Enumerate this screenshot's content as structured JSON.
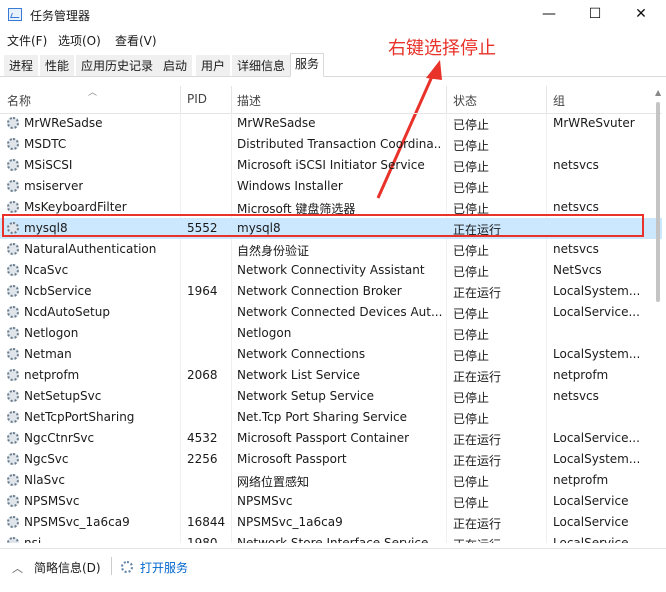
{
  "window": {
    "title": "任务管理器",
    "minimize": "—",
    "maximize": "☐",
    "close": "✕"
  },
  "menu": [
    "文件(F)",
    "选项(O)",
    "查看(V)"
  ],
  "tabs": [
    "进程",
    "性能",
    "应用历史记录",
    "启动",
    "用户",
    "详细信息",
    "服务"
  ],
  "active_tab": "服务",
  "annotation": {
    "text": "右键选择停止",
    "color": "#e8322a"
  },
  "columns": [
    "名称",
    "PID",
    "描述",
    "状态",
    "组"
  ],
  "services": [
    {
      "name": "MrWReSadse",
      "pid": "",
      "desc": "MrWReSadse",
      "status": "已停止",
      "group": "MrWReSvuter"
    },
    {
      "name": "MSDTC",
      "pid": "",
      "desc": "Distributed Transaction Coordina...",
      "status": "已停止",
      "group": ""
    },
    {
      "name": "MSiSCSI",
      "pid": "",
      "desc": "Microsoft iSCSI Initiator Service",
      "status": "已停止",
      "group": "netsvcs"
    },
    {
      "name": "msiserver",
      "pid": "",
      "desc": "Windows Installer",
      "status": "已停止",
      "group": ""
    },
    {
      "name": "MsKeyboardFilter",
      "pid": "",
      "desc": "Microsoft 键盘筛选器",
      "status": "已停止",
      "group": "netsvcs"
    },
    {
      "name": "mysql8",
      "pid": "5552",
      "desc": "mysql8",
      "status": "正在运行",
      "group": ""
    },
    {
      "name": "NaturalAuthentication",
      "pid": "",
      "desc": "自然身份验证",
      "status": "已停止",
      "group": "netsvcs"
    },
    {
      "name": "NcaSvc",
      "pid": "",
      "desc": "Network Connectivity Assistant",
      "status": "已停止",
      "group": "NetSvcs"
    },
    {
      "name": "NcbService",
      "pid": "1964",
      "desc": "Network Connection Broker",
      "status": "正在运行",
      "group": "LocalSystem..."
    },
    {
      "name": "NcdAutoSetup",
      "pid": "",
      "desc": "Network Connected Devices Aut...",
      "status": "已停止",
      "group": "LocalService..."
    },
    {
      "name": "Netlogon",
      "pid": "",
      "desc": "Netlogon",
      "status": "已停止",
      "group": ""
    },
    {
      "name": "Netman",
      "pid": "",
      "desc": "Network Connections",
      "status": "已停止",
      "group": "LocalSystem..."
    },
    {
      "name": "netprofm",
      "pid": "2068",
      "desc": "Network List Service",
      "status": "正在运行",
      "group": "netprofm"
    },
    {
      "name": "NetSetupSvc",
      "pid": "",
      "desc": "Network Setup Service",
      "status": "已停止",
      "group": "netsvcs"
    },
    {
      "name": "NetTcpPortSharing",
      "pid": "",
      "desc": "Net.Tcp Port Sharing Service",
      "status": "已停止",
      "group": ""
    },
    {
      "name": "NgcCtnrSvc",
      "pid": "4532",
      "desc": "Microsoft Passport Container",
      "status": "正在运行",
      "group": "LocalService..."
    },
    {
      "name": "NgcSvc",
      "pid": "2256",
      "desc": "Microsoft Passport",
      "status": "正在运行",
      "group": "LocalSystem..."
    },
    {
      "name": "NlaSvc",
      "pid": "",
      "desc": "网络位置感知",
      "status": "已停止",
      "group": "netprofm"
    },
    {
      "name": "NPSMSvc",
      "pid": "",
      "desc": "NPSMSvc",
      "status": "已停止",
      "group": "LocalService"
    },
    {
      "name": "NPSMSvc_1a6ca9",
      "pid": "16844",
      "desc": "NPSMSvc_1a6ca9",
      "status": "正在运行",
      "group": "LocalService"
    },
    {
      "name": "nsi",
      "pid": "1980",
      "desc": "Network Store Interface Service",
      "status": "正在运行",
      "group": "LocalService"
    }
  ],
  "selected_service": "mysql8",
  "footer": {
    "less_details": "简略信息(D)",
    "open_services": "打开服务"
  }
}
